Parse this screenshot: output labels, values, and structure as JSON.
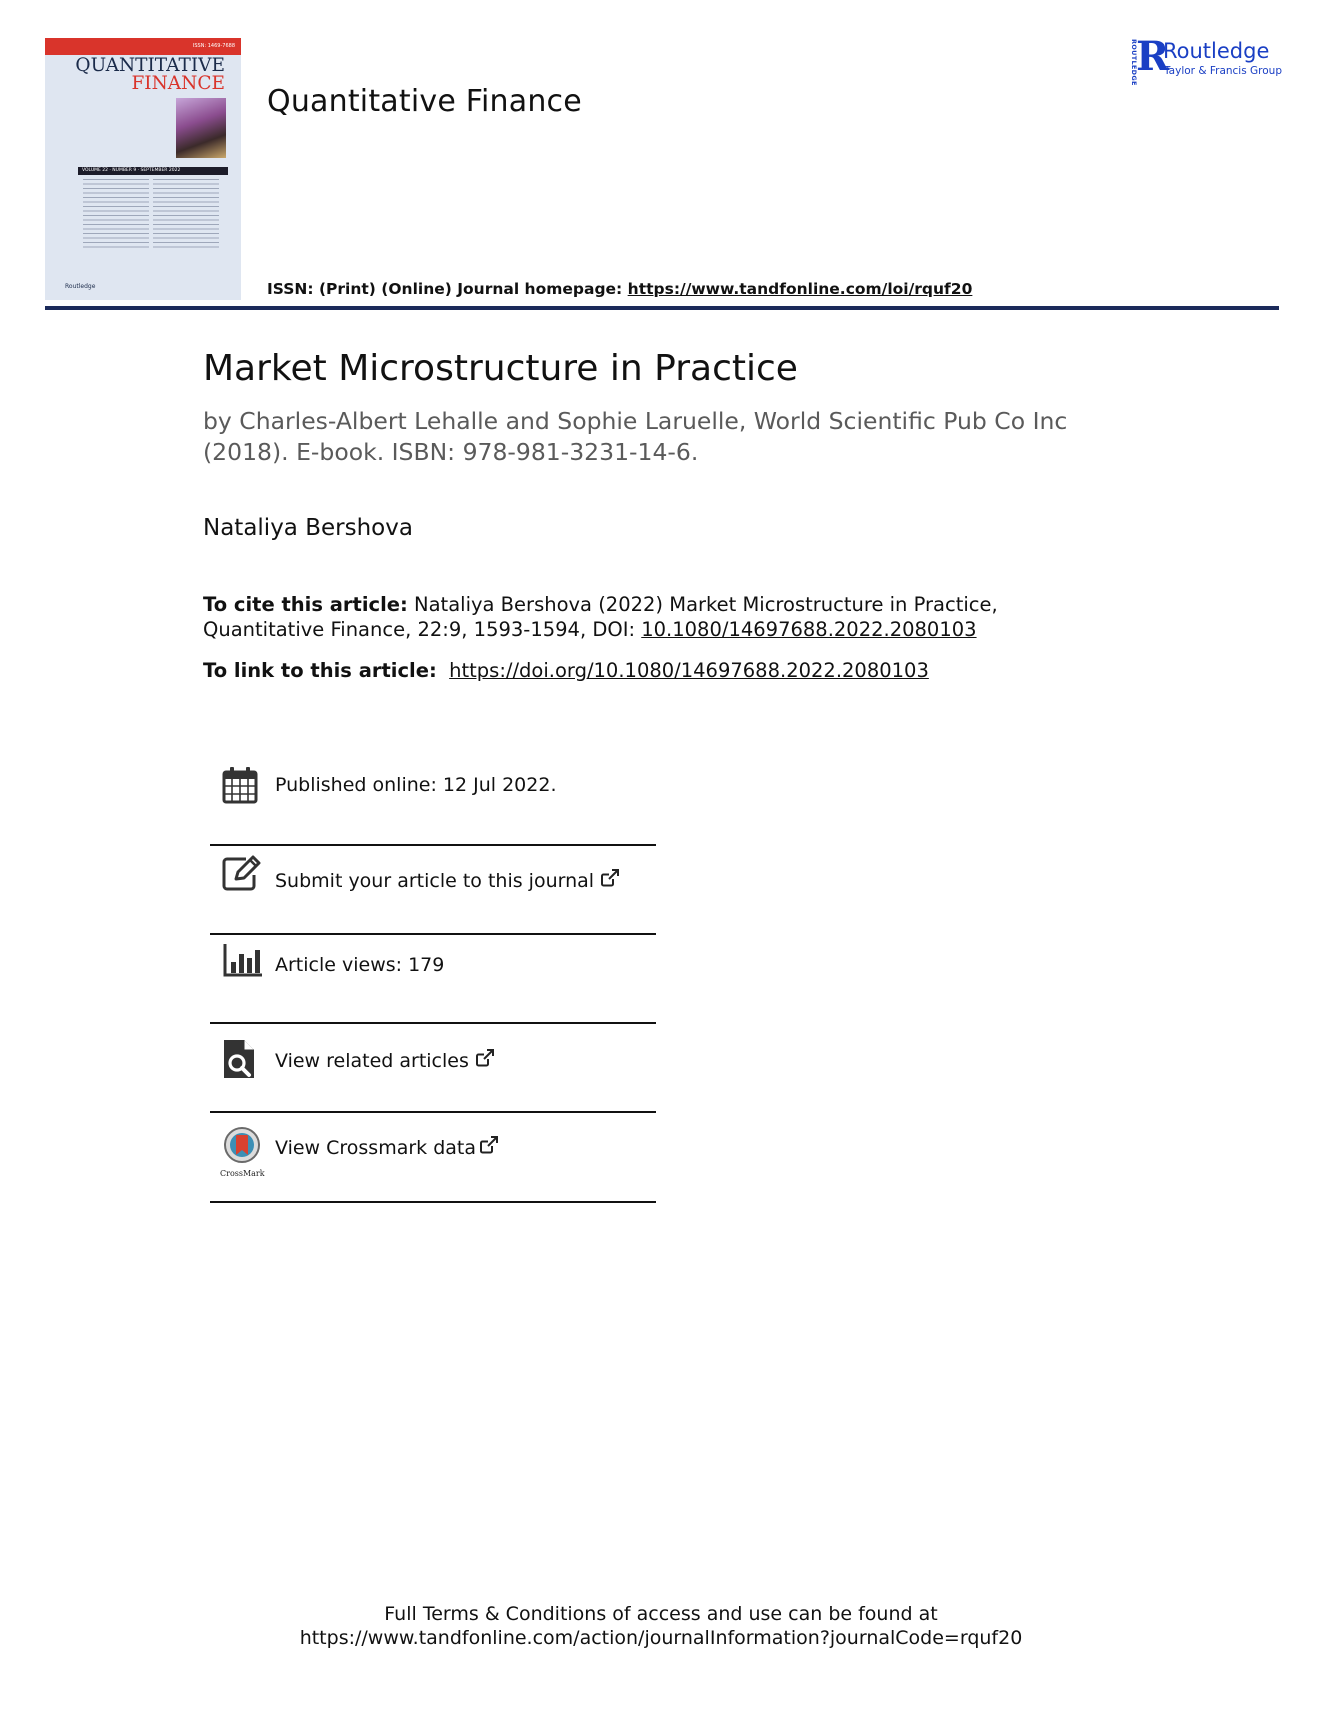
{
  "cover": {
    "issn_tag": "ISSN: 1469-7688",
    "title": "QUANTITATIVE",
    "subtitle": "FINANCE",
    "volume_line": "VOLUME 22 · NUMBER 9 · SEPTEMBER 2022",
    "publisher": "Routledge"
  },
  "journal": {
    "name": "Quantitative Finance",
    "issn_label": "ISSN: (Print) (Online) Journal homepage:",
    "homepage_url": "https://www.tandfonline.com/loi/rquf20"
  },
  "publisher_logo": {
    "vertical": "ROUTLEDGE",
    "name": "Routledge",
    "sub": "Taylor & Francis Group"
  },
  "article": {
    "title": "Market Microstructure in Practice",
    "subtitle": "by Charles-Albert Lehalle and Sophie Laruelle, World Scientific Pub Co Inc (2018). E-book. ISBN: 978-981-3231-14-6.",
    "author": "Nataliya Bershova",
    "cite_label": "To cite this article:",
    "cite_text": "Nataliya Bershova (2022) Market Microstructure in Practice, Quantitative Finance, 22:9, 1593-1594, DOI:",
    "cite_doi": "10.1080/14697688.2022.2080103",
    "link_label": "To link to this article:",
    "link_url": "https://doi.org/10.1080/14697688.2022.2080103"
  },
  "info": {
    "published": "Published online: 12 Jul 2022.",
    "submit": "Submit your article to this journal",
    "views": "Article views: 179",
    "related": "View related articles",
    "crossmark": "View Crossmark data",
    "crossmark_logo_text": "CrossMark"
  },
  "footer": {
    "line1": "Full Terms & Conditions of access and use can be found at",
    "line2": "https://www.tandfonline.com/action/journalInformation?journalCode=rquf20"
  },
  "colors": {
    "rule": "#1b2a5a",
    "routledge_blue": "#1a3fc4",
    "cover_red": "#d9342b",
    "subtitle_gray": "#5a5a5a"
  }
}
